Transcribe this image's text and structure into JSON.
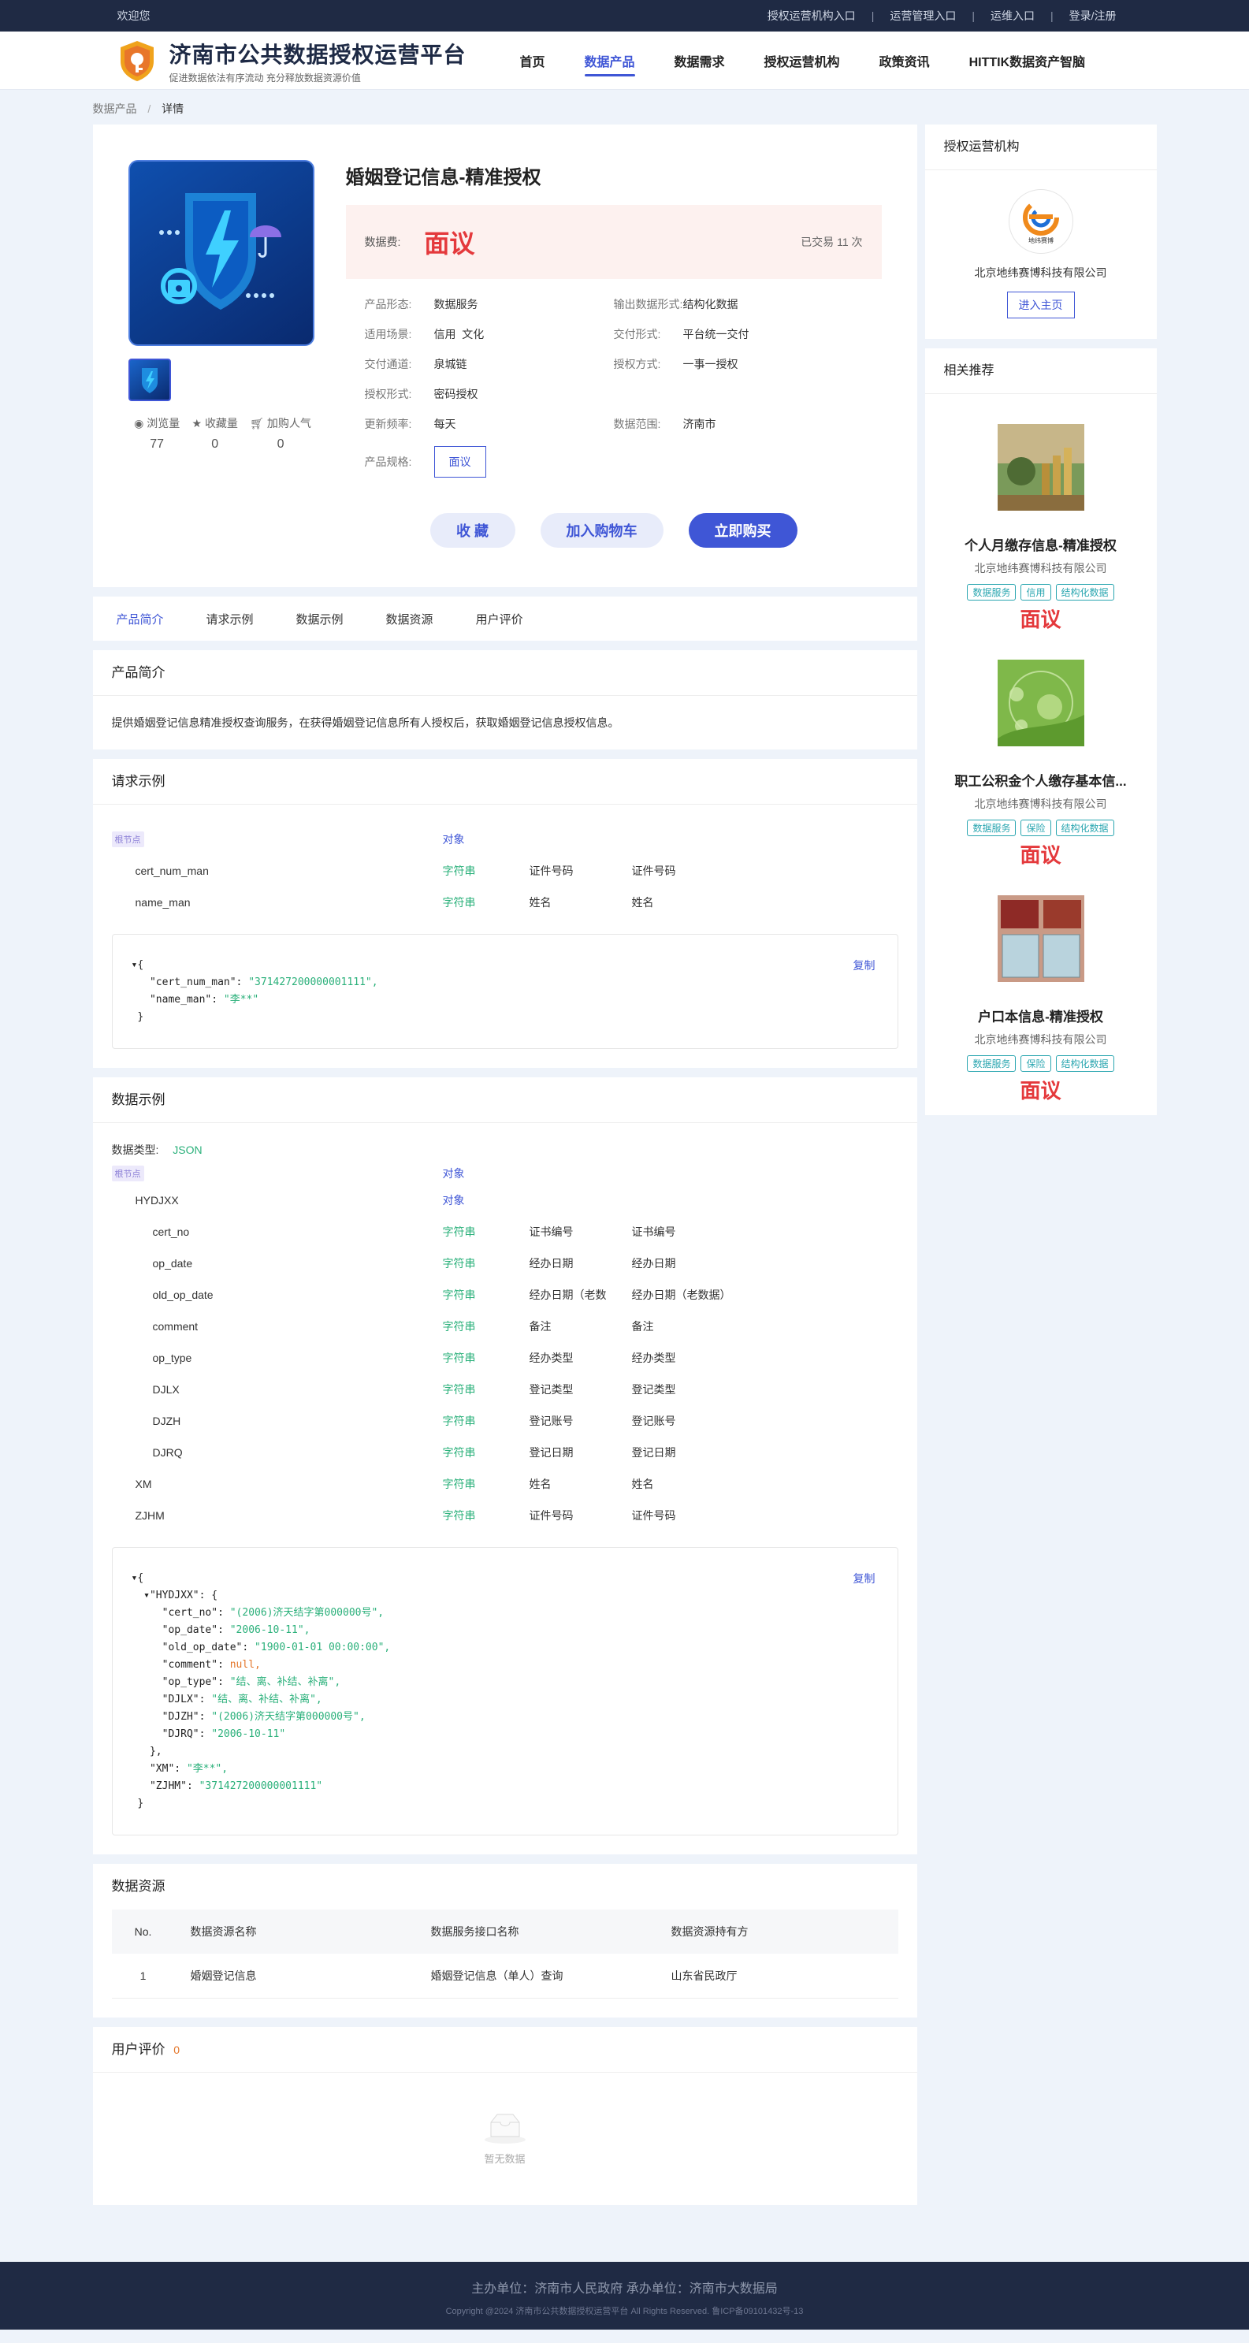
{
  "topbar": {
    "welcome": "欢迎您",
    "links": [
      "授权运营机构入口",
      "运营管理入口",
      "运维入口",
      "登录/注册"
    ]
  },
  "header": {
    "title": "济南市公共数据授权运营平台",
    "subtitle": "促进数据依法有序流动 充分释放数据资源价值",
    "nav": [
      "首页",
      "数据产品",
      "数据需求",
      "授权运营机构",
      "政策资讯",
      "HITTIK数据资产智脑"
    ],
    "active_nav": "数据产品"
  },
  "breadcrumb": {
    "parent": "数据产品",
    "separator": "/",
    "current": "详情"
  },
  "product": {
    "title": "婚姻登记信息-精准授权",
    "price_label": "数据费:",
    "price": "面议",
    "trade_count": "已交易 11 次",
    "stats": [
      {
        "label": "浏览量",
        "value": "77",
        "icon": "eye-icon"
      },
      {
        "label": "收藏量",
        "value": "0",
        "icon": "star-icon"
      },
      {
        "label": "加购人气",
        "value": "0",
        "icon": "cart-icon"
      }
    ],
    "attributes": [
      {
        "key": "产品形态:",
        "value": "数据服务"
      },
      {
        "key": "输出数据形式:",
        "value": "结构化数据"
      },
      {
        "key": "适用场景:",
        "value": "信用  文化"
      },
      {
        "key": "交付形式:",
        "value": "平台统一交付"
      },
      {
        "key": "交付通道:",
        "value": "泉城链"
      },
      {
        "key": "授权方式:",
        "value": "一事一授权"
      },
      {
        "key": "授权形式:",
        "value": "密码授权"
      },
      {
        "key": "",
        "value": ""
      },
      {
        "key": "更新频率:",
        "value": "每天"
      },
      {
        "key": "数据范围:",
        "value": "济南市"
      }
    ],
    "spec_label": "产品规格:",
    "spec_value": "面议",
    "buttons": {
      "favorite": "收 藏",
      "add_cart": "加入购物车",
      "buy": "立即购买"
    }
  },
  "tabs": [
    "产品简介",
    "请求示例",
    "数据示例",
    "数据资源",
    "用户评价"
  ],
  "intro": {
    "title": "产品简介",
    "text": "提供婚姻登记信息精准授权查询服务，在获得婚姻登记信息所有人授权后，获取婚姻登记信息授权信息。"
  },
  "request_example": {
    "title": "请求示例",
    "root_tag": "根节点",
    "root_type": "对象",
    "fields": [
      {
        "name": "cert_num_man",
        "type": "字符串",
        "label": "证件号码",
        "desc": "证件号码"
      },
      {
        "name": "name_man",
        "type": "字符串",
        "label": "姓名",
        "desc": "姓名"
      }
    ],
    "copy": "复制",
    "json_lines": [
      "▾{",
      "   \"cert_num_man\": \"371427200000001111\",",
      "   \"name_man\": \"李**\"",
      " }"
    ]
  },
  "data_example": {
    "title": "数据示例",
    "dtype_label": "数据类型:",
    "dtype_value": "JSON",
    "root_tag": "根节点",
    "root_type": "对象",
    "fields": [
      {
        "name": "HYDJXX",
        "type": "对象",
        "label": "",
        "desc": "",
        "level": 1
      },
      {
        "name": "cert_no",
        "type": "字符串",
        "label": "证书编号",
        "desc": "证书编号",
        "level": 2
      },
      {
        "name": "op_date",
        "type": "字符串",
        "label": "经办日期",
        "desc": "经办日期",
        "level": 2
      },
      {
        "name": "old_op_date",
        "type": "字符串",
        "label": "经办日期（老数",
        "desc": "经办日期（老数据）",
        "level": 2
      },
      {
        "name": "comment",
        "type": "字符串",
        "label": "备注",
        "desc": "备注",
        "level": 2
      },
      {
        "name": "op_type",
        "type": "字符串",
        "label": "经办类型",
        "desc": "经办类型",
        "level": 2
      },
      {
        "name": "DJLX",
        "type": "字符串",
        "label": "登记类型",
        "desc": "登记类型",
        "level": 2
      },
      {
        "name": "DJZH",
        "type": "字符串",
        "label": "登记账号",
        "desc": "登记账号",
        "level": 2
      },
      {
        "name": "DJRQ",
        "type": "字符串",
        "label": "登记日期",
        "desc": "登记日期",
        "level": 2
      },
      {
        "name": "XM",
        "type": "字符串",
        "label": "姓名",
        "desc": "姓名",
        "level": 1
      },
      {
        "name": "ZJHM",
        "type": "字符串",
        "label": "证件号码",
        "desc": "证件号码",
        "level": 1
      }
    ],
    "copy": "复制",
    "json_lines": [
      "▾{",
      "  ▾\"HYDJXX\": {",
      "     \"cert_no\": \"(2006)济天结字第000000号\",",
      "     \"op_date\": \"2006-10-11\",",
      "     \"old_op_date\": \"1900-01-01 00:00:00\",",
      "     \"comment\": null,",
      "     \"op_type\": \"结、离、补结、补离\",",
      "     \"DJLX\": \"结、离、补结、补离\",",
      "     \"DJZH\": \"(2006)济天结字第000000号\",",
      "     \"DJRQ\": \"2006-10-11\"",
      "   },",
      "   \"XM\": \"李**\",",
      "   \"ZJHM\": \"371427200000001111\"",
      " }"
    ]
  },
  "resources": {
    "title": "数据资源",
    "headers": [
      "No.",
      "数据资源名称",
      "数据服务接口名称",
      "数据资源持有方"
    ],
    "rows": [
      [
        "1",
        "婚姻登记信息",
        "婚姻登记信息（单人）查询",
        "山东省民政厅"
      ]
    ]
  },
  "reviews": {
    "title": "用户评价",
    "count": "0",
    "empty": "暂无数据"
  },
  "sidebar": {
    "org_title": "授权运营机构",
    "org_logo_text": "地纬赛博",
    "org_name": "北京地纬赛博科技有限公司",
    "org_button": "进入主页",
    "rec_title": "相关推荐",
    "recommendations": [
      {
        "title": "个人月缴存信息-精准授权",
        "org": "北京地纬赛博科技有限公司",
        "tags": [
          "数据服务",
          "信用",
          "结构化数据"
        ],
        "price": "面议"
      },
      {
        "title": "职工公积金个人缴存基本信...",
        "org": "北京地纬赛博科技有限公司",
        "tags": [
          "数据服务",
          "保险",
          "结构化数据"
        ],
        "price": "面议"
      },
      {
        "title": "户口本信息-精准授权",
        "org": "北京地纬赛博科技有限公司",
        "tags": [
          "数据服务",
          "保险",
          "结构化数据"
        ],
        "price": "面议"
      }
    ]
  },
  "footer": {
    "line1": "主办单位：济南市人民政府     承办单位：济南市大数据局",
    "line2": "Copyright @2024 济南市公共数据授权运营平台 All Rights Reserved. 鲁ICP备09101432号-13"
  },
  "colors": {
    "accent": "#3f56d6",
    "price": "#e4393c",
    "string_type": "#2ab07a",
    "tag": "#2aa6b0",
    "topbar": "#1f2a44"
  }
}
